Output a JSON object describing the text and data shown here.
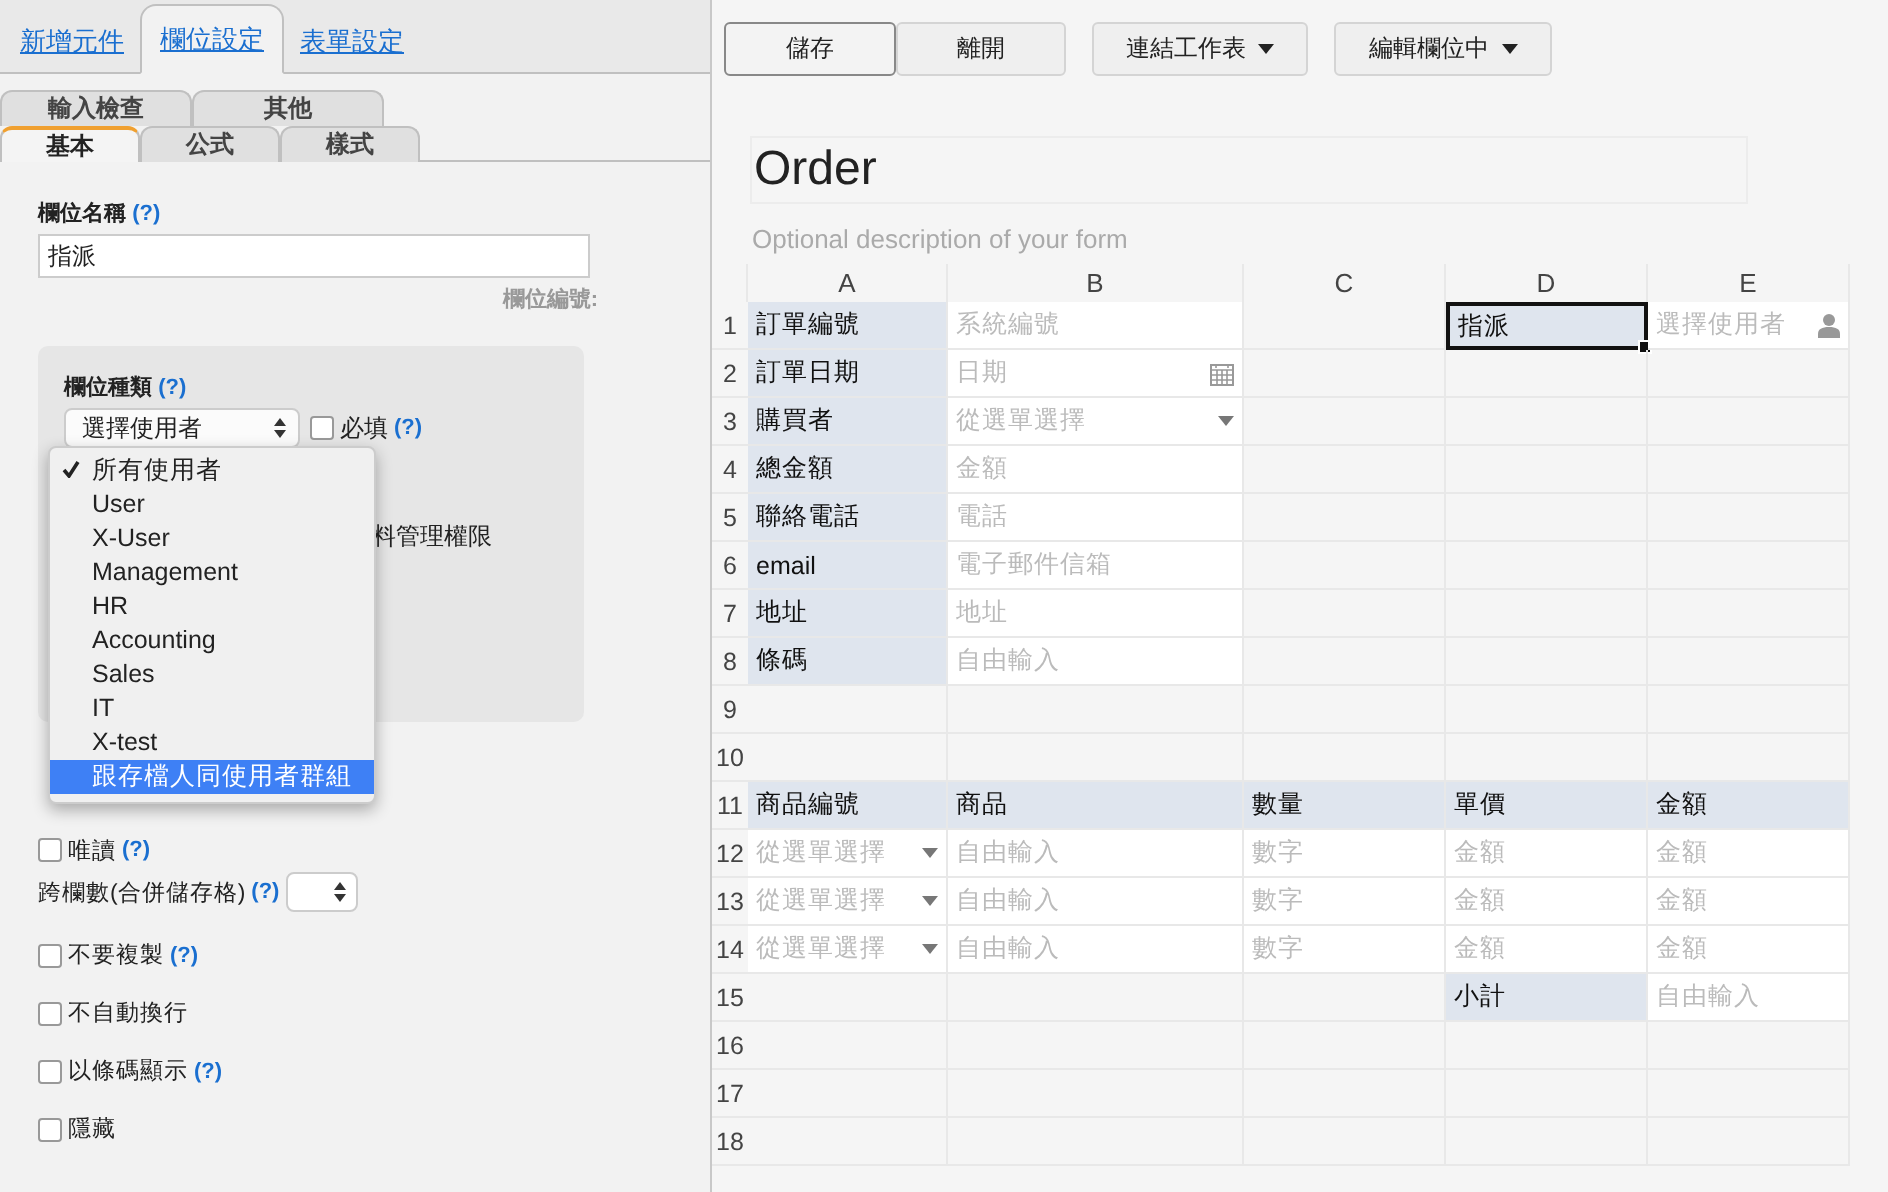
{
  "panel_tabs": [
    {
      "label": "新增元件",
      "selected": false
    },
    {
      "label": "欄位設定",
      "selected": true
    },
    {
      "label": "表單設定",
      "selected": false
    }
  ],
  "sub_tabs": [
    [
      {
        "label": "輸入檢查",
        "selected": false
      },
      {
        "label": "其他",
        "selected": false
      }
    ],
    [
      {
        "label": "基本",
        "selected": true
      },
      {
        "label": "公式",
        "selected": false
      },
      {
        "label": "樣式",
        "selected": false
      }
    ]
  ],
  "field_name": {
    "label": "欄位名稱",
    "help": "(?)",
    "value": "指派",
    "id_label": "欄位編號:"
  },
  "field_type": {
    "label": "欄位種類",
    "help": "(?)",
    "value": "選擇使用者",
    "required": {
      "label": "必填",
      "help": "(?)",
      "checked": false
    },
    "partial_text": "料管理權限"
  },
  "dropdown": [
    {
      "label": "所有使用者",
      "checked": true,
      "selected": false
    },
    {
      "label": "User",
      "checked": false,
      "selected": false
    },
    {
      "label": "X-User",
      "checked": false,
      "selected": false
    },
    {
      "label": "Management",
      "checked": false,
      "selected": false
    },
    {
      "label": "HR",
      "checked": false,
      "selected": false
    },
    {
      "label": "Accounting",
      "checked": false,
      "selected": false
    },
    {
      "label": "Sales",
      "checked": false,
      "selected": false
    },
    {
      "label": "IT",
      "checked": false,
      "selected": false
    },
    {
      "label": "X-test",
      "checked": false,
      "selected": false
    },
    {
      "label": "跟存檔人同使用者群組",
      "checked": false,
      "selected": true
    }
  ],
  "options": [
    {
      "kind": "checkbox",
      "label": "唯讀",
      "help": "(?)",
      "checked": false
    },
    {
      "kind": "select",
      "label": "跨欄數(合併儲存格)",
      "help": "(?)"
    },
    {
      "kind": "checkbox",
      "label": "不要複製",
      "help": "(?)",
      "checked": false
    },
    {
      "kind": "checkbox",
      "label": "不自動換行",
      "checked": false
    },
    {
      "kind": "checkbox",
      "label": "以條碼顯示",
      "help": "(?)",
      "checked": false
    },
    {
      "kind": "checkbox",
      "label": "隱藏",
      "checked": false
    }
  ],
  "toolbar": [
    {
      "label": "儲存",
      "menu": false,
      "focused": true
    },
    {
      "label": "離開",
      "menu": false,
      "focused": false
    },
    {
      "label": "連結工作表",
      "menu": true,
      "focused": false
    },
    {
      "label": "編輯欄位中",
      "menu": true,
      "focused": false
    }
  ],
  "form": {
    "title": "Order",
    "description_placeholder": "Optional description of your form"
  },
  "columns": [
    "A",
    "B",
    "C",
    "D",
    "E"
  ],
  "rows": [
    {
      "num": "1",
      "cells": [
        {
          "kind": "label",
          "text": "訂單編號",
          "selected": false
        },
        {
          "kind": "text",
          "text": "系統編號",
          "selected": false
        },
        {
          "kind": "empty",
          "selected": false
        },
        {
          "kind": "label",
          "text": "指派",
          "selected": true
        },
        {
          "kind": "user",
          "text": "選擇使用者",
          "selected": false
        }
      ]
    },
    {
      "num": "2",
      "cells": [
        {
          "kind": "label",
          "text": "訂單日期",
          "selected": false
        },
        {
          "kind": "date",
          "text": "日期",
          "selected": false
        },
        {
          "kind": "empty",
          "selected": false
        },
        {
          "kind": "empty",
          "selected": false
        },
        {
          "kind": "empty",
          "selected": false
        }
      ]
    },
    {
      "num": "3",
      "cells": [
        {
          "kind": "label",
          "text": "購買者",
          "selected": false
        },
        {
          "kind": "select",
          "text": "從選單選擇",
          "selected": false
        },
        {
          "kind": "empty",
          "selected": false
        },
        {
          "kind": "empty",
          "selected": false
        },
        {
          "kind": "empty",
          "selected": false
        }
      ]
    },
    {
      "num": "4",
      "cells": [
        {
          "kind": "label",
          "text": "總金額",
          "selected": false
        },
        {
          "kind": "text",
          "text": "金額",
          "selected": false
        },
        {
          "kind": "empty",
          "selected": false
        },
        {
          "kind": "empty",
          "selected": false
        },
        {
          "kind": "empty",
          "selected": false
        }
      ]
    },
    {
      "num": "5",
      "cells": [
        {
          "kind": "label",
          "text": "聯絡電話",
          "selected": false
        },
        {
          "kind": "text",
          "text": "電話",
          "selected": false
        },
        {
          "kind": "empty",
          "selected": false
        },
        {
          "kind": "empty",
          "selected": false
        },
        {
          "kind": "empty",
          "selected": false
        }
      ]
    },
    {
      "num": "6",
      "cells": [
        {
          "kind": "label",
          "text": "email",
          "selected": false
        },
        {
          "kind": "text",
          "text": "電子郵件信箱",
          "selected": false
        },
        {
          "kind": "empty",
          "selected": false
        },
        {
          "kind": "empty",
          "selected": false
        },
        {
          "kind": "empty",
          "selected": false
        }
      ]
    },
    {
      "num": "7",
      "cells": [
        {
          "kind": "label",
          "text": "地址",
          "selected": false
        },
        {
          "kind": "text",
          "text": "地址",
          "selected": false
        },
        {
          "kind": "empty",
          "selected": false
        },
        {
          "kind": "empty",
          "selected": false
        },
        {
          "kind": "empty",
          "selected": false
        }
      ]
    },
    {
      "num": "8",
      "cells": [
        {
          "kind": "label",
          "text": "條碼",
          "selected": false
        },
        {
          "kind": "text",
          "text": "自由輸入",
          "selected": false
        },
        {
          "kind": "empty",
          "selected": false
        },
        {
          "kind": "empty",
          "selected": false
        },
        {
          "kind": "empty",
          "selected": false
        }
      ]
    },
    {
      "num": "9",
      "cells": [
        {
          "kind": "empty",
          "selected": false
        },
        {
          "kind": "empty",
          "selected": false
        },
        {
          "kind": "empty",
          "selected": false
        },
        {
          "kind": "empty",
          "selected": false
        },
        {
          "kind": "empty",
          "selected": false
        }
      ]
    },
    {
      "num": "10",
      "cells": [
        {
          "kind": "empty",
          "selected": false
        },
        {
          "kind": "empty",
          "selected": false
        },
        {
          "kind": "empty",
          "selected": false
        },
        {
          "kind": "empty",
          "selected": false
        },
        {
          "kind": "empty",
          "selected": false
        }
      ]
    },
    {
      "num": "11",
      "cells": [
        {
          "kind": "label",
          "text": "商品編號",
          "selected": false
        },
        {
          "kind": "label",
          "text": "商品",
          "selected": false
        },
        {
          "kind": "label",
          "text": "數量",
          "selected": false
        },
        {
          "kind": "label",
          "text": "單價",
          "selected": false
        },
        {
          "kind": "label",
          "text": "金額",
          "selected": false
        }
      ]
    },
    {
      "num": "12",
      "cells": [
        {
          "kind": "select",
          "text": "從選單選擇",
          "selected": false
        },
        {
          "kind": "text",
          "text": "自由輸入",
          "selected": false
        },
        {
          "kind": "text",
          "text": "數字",
          "selected": false
        },
        {
          "kind": "text",
          "text": "金額",
          "selected": false
        },
        {
          "kind": "text",
          "text": "金額",
          "selected": false
        }
      ]
    },
    {
      "num": "13",
      "cells": [
        {
          "kind": "select",
          "text": "從選單選擇",
          "selected": false
        },
        {
          "kind": "text",
          "text": "自由輸入",
          "selected": false
        },
        {
          "kind": "text",
          "text": "數字",
          "selected": false
        },
        {
          "kind": "text",
          "text": "金額",
          "selected": false
        },
        {
          "kind": "text",
          "text": "金額",
          "selected": false
        }
      ]
    },
    {
      "num": "14",
      "cells": [
        {
          "kind": "select",
          "text": "從選單選擇",
          "selected": false
        },
        {
          "kind": "text",
          "text": "自由輸入",
          "selected": false
        },
        {
          "kind": "text",
          "text": "數字",
          "selected": false
        },
        {
          "kind": "text",
          "text": "金額",
          "selected": false
        },
        {
          "kind": "text",
          "text": "金額",
          "selected": false
        }
      ]
    },
    {
      "num": "15",
      "cells": [
        {
          "kind": "empty",
          "selected": false
        },
        {
          "kind": "empty",
          "selected": false
        },
        {
          "kind": "empty",
          "selected": false
        },
        {
          "kind": "label",
          "text": "小計",
          "selected": false
        },
        {
          "kind": "text",
          "text": "自由輸入",
          "selected": false
        }
      ]
    },
    {
      "num": "16",
      "cells": [
        {
          "kind": "empty",
          "selected": false
        },
        {
          "kind": "empty",
          "selected": false
        },
        {
          "kind": "empty",
          "selected": false
        },
        {
          "kind": "empty",
          "selected": false
        },
        {
          "kind": "empty",
          "selected": false
        }
      ]
    },
    {
      "num": "17",
      "cells": [
        {
          "kind": "empty",
          "selected": false
        },
        {
          "kind": "empty",
          "selected": false
        },
        {
          "kind": "empty",
          "selected": false
        },
        {
          "kind": "empty",
          "selected": false
        },
        {
          "kind": "empty",
          "selected": false
        }
      ]
    },
    {
      "num": "18",
      "cells": [
        {
          "kind": "empty",
          "selected": false
        },
        {
          "kind": "empty",
          "selected": false
        },
        {
          "kind": "empty",
          "selected": false
        },
        {
          "kind": "empty",
          "selected": false
        },
        {
          "kind": "empty",
          "selected": false
        }
      ]
    }
  ]
}
